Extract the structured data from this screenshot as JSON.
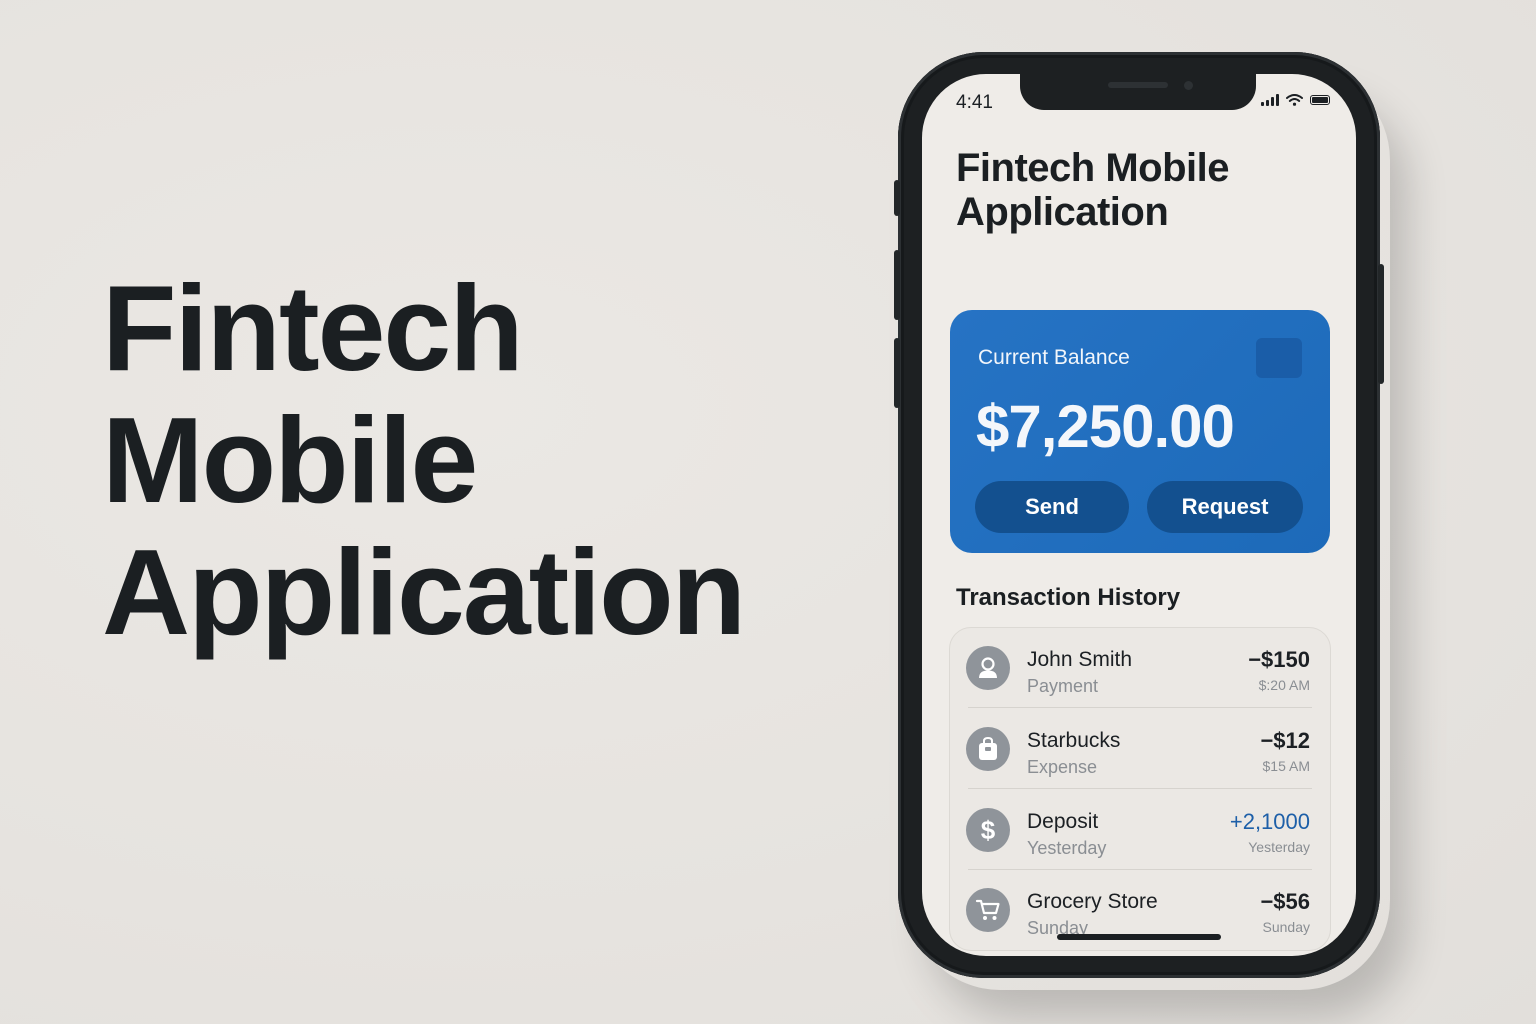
{
  "hero": {
    "line1": "Fintech",
    "line2": "Mobile",
    "line3": "Application"
  },
  "status_bar": {
    "time": "4:41",
    "icons": [
      "signal-icon",
      "wifi-icon",
      "battery-icon"
    ]
  },
  "app": {
    "title_line1": "Fintech Mobile",
    "title_line2": "Application"
  },
  "balance_card": {
    "label": "Current Balance",
    "amount": "$7,250.00",
    "send_label": "Send",
    "request_label": "Request",
    "color": "#2673c4",
    "button_color": "#13508f"
  },
  "transactions": {
    "title": "Transaction History",
    "items": [
      {
        "icon": "user-icon",
        "name": "John Smith",
        "type": "Payment",
        "amount": "−$150",
        "time": "$:20 AM",
        "direction": "debit"
      },
      {
        "icon": "shopping-bag-icon",
        "name": "Starbucks",
        "type": "Expense",
        "amount": "−$12",
        "time": "$15 AM",
        "direction": "debit"
      },
      {
        "icon": "dollar-icon",
        "name": "Deposit",
        "type": "Yesterday",
        "amount": "+2,1000",
        "time": "Yesterday",
        "direction": "credit"
      },
      {
        "icon": "cart-icon",
        "name": "Grocery Store",
        "type": "Sunday",
        "amount": "−$56",
        "time": "Sunday",
        "direction": "debit"
      }
    ]
  },
  "colors": {
    "background": "#e8e5e1",
    "text_dark": "#1b1f22",
    "positive_amount": "#1d5fa8",
    "muted": "#8a8e93"
  }
}
